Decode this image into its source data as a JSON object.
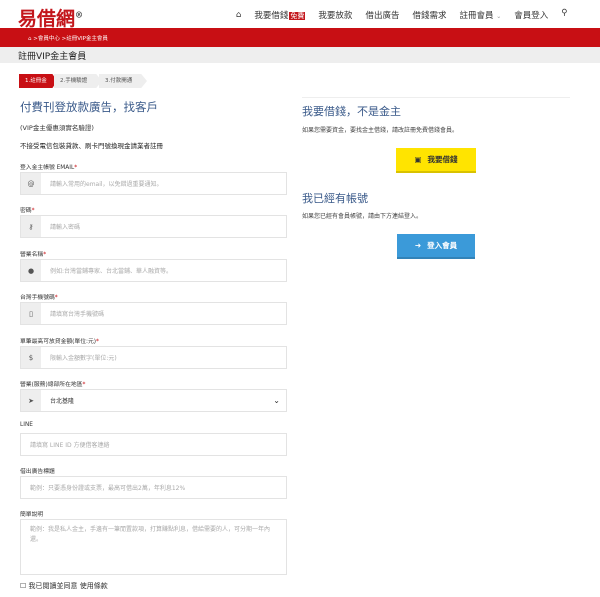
{
  "header": {
    "logo": "易借網",
    "logo_mark": "®",
    "nav": [
      {
        "label": "我要借錢",
        "badge": "免費"
      },
      {
        "label": "我要放款"
      },
      {
        "label": "借出廣告"
      },
      {
        "label": "借錢需求"
      },
      {
        "label": "註冊會員",
        "dropdown": true
      },
      {
        "label": "會員登入"
      }
    ]
  },
  "breadcrumb": {
    "items": [
      "會員中心",
      "註冊VIP金主會員"
    ],
    "sep": ">"
  },
  "page_title": "註冊VIP金主會員",
  "steps": [
    "1.註冊金主",
    "2.手機驗證",
    "3.付款開通"
  ],
  "form": {
    "heading": "付費刊登放款廣告，找客戶",
    "subheading": "(VIP金主優惠須實名驗證)",
    "notice": "不接受電信包裝貸款、刷卡門號換現金請業者註冊",
    "fields": [
      {
        "label": "登入金主帳號 EMAIL",
        "required": true,
        "icon": "at-icon",
        "placeholder": "請輸入常用的email，以免錯過重要通知。"
      },
      {
        "label": "密碼",
        "required": true,
        "icon": "key-icon",
        "placeholder": "請輸入密碼"
      },
      {
        "label": "營業名稱",
        "required": true,
        "icon": "user-icon",
        "placeholder": "例如:台灣當鋪專家、台北當鋪、華人融資等。"
      },
      {
        "label": "台灣手機號碼",
        "required": true,
        "icon": "mobile-icon",
        "placeholder": "請填寫台灣手機號碼"
      },
      {
        "label": "單筆最高可放貸金額(單位:元)",
        "required": true,
        "icon": "dollar-icon",
        "placeholder": "限輸入金額數字(單位:元)"
      },
      {
        "label": "營業(服務)總部所在地區",
        "required": true,
        "icon": "location-arrow-icon",
        "value": "台北基隆"
      },
      {
        "label": "LINE",
        "placeholder": "請填寫 LINE ID 方便借客連絡"
      },
      {
        "label": "借出廣告標題",
        "placeholder": "範例：只要憑身份證或支票，最高可借出2萬，年利息12%"
      },
      {
        "label": "簡單說明",
        "placeholder": "範例：我是私人金主，手邊有一筆閒置款項，打算賺點利息，借給需要的人，可分期一年內還。"
      }
    ],
    "terms_prefix": "我已閱讀並同意",
    "terms_link": "使用條款"
  },
  "sidebar": {
    "borrow_heading": "我要借錢，不是金主",
    "borrow_text": "如果您需要資金，要找金主借錢，請改註冊免費借錢會員。",
    "borrow_button": "我要借錢",
    "login_heading": "我已經有帳號",
    "login_text": "如果您已經有會員帳號，請由下方連結登入。",
    "login_button": "登入會員"
  },
  "colors": {
    "brand_red": "#c80f14",
    "heading_blue": "#3a5a8a",
    "borrow_yellow": "#ffe400",
    "login_blue": "#3b9ad9"
  }
}
